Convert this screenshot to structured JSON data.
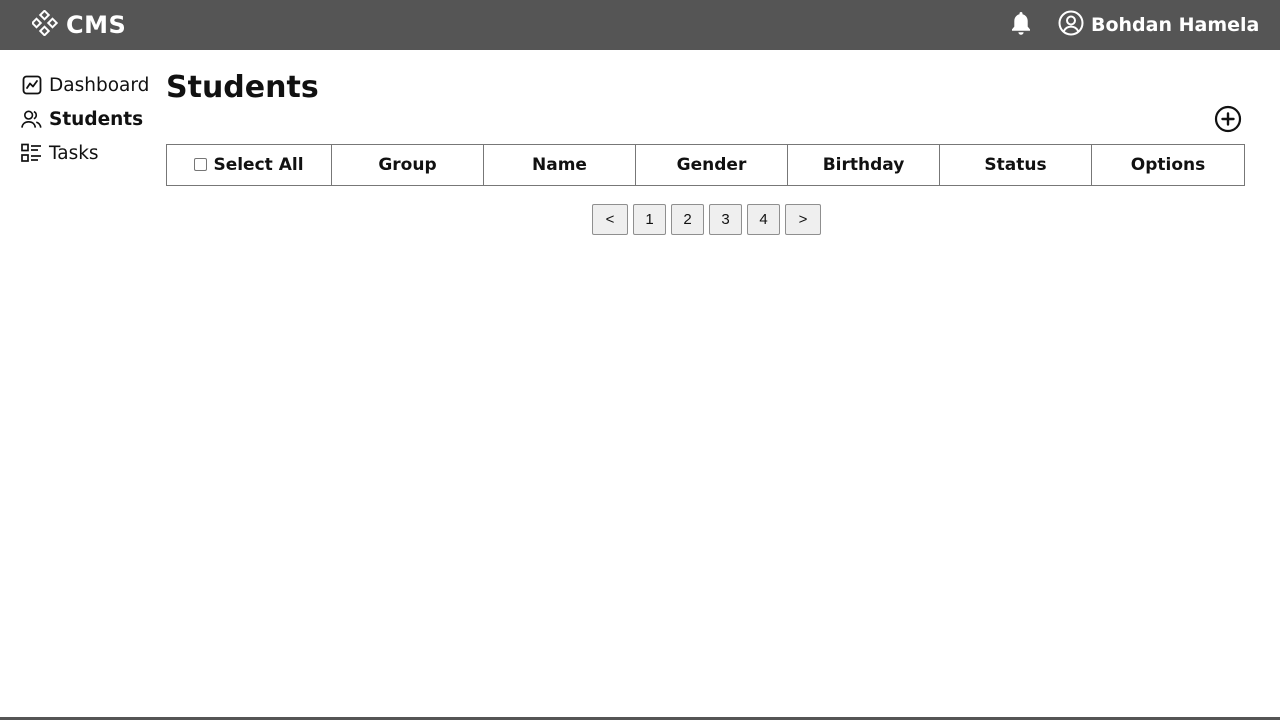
{
  "header": {
    "brand": "CMS",
    "brand_icon": "diamond-grid-icon",
    "notifications_icon": "bell-icon",
    "user_icon": "user-circle-icon",
    "user_name": "Bohdan Hamela"
  },
  "sidebar": {
    "items": [
      {
        "label": "Dashboard",
        "icon": "chart-icon",
        "active": false
      },
      {
        "label": "Students",
        "icon": "users-icon",
        "active": true
      },
      {
        "label": "Tasks",
        "icon": "list-icon",
        "active": false
      }
    ]
  },
  "main": {
    "title": "Students",
    "add_icon": "plus-circle-icon",
    "table": {
      "columns": [
        "Select All",
        "Group",
        "Name",
        "Gender",
        "Birthday",
        "Status",
        "Options"
      ],
      "rows": []
    },
    "pagination": {
      "prev": "<",
      "pages": [
        "1",
        "2",
        "3",
        "4"
      ],
      "next": ">"
    }
  },
  "colors": {
    "header_bg": "#555555",
    "header_text": "#ffffff"
  }
}
